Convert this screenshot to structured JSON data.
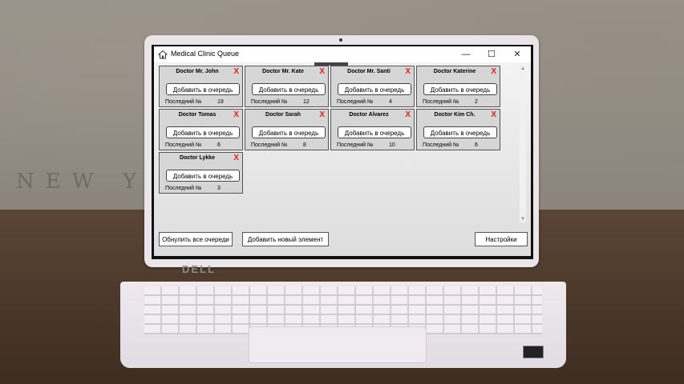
{
  "window": {
    "title": "Medical Clinic Queue",
    "minimize_glyph": "—",
    "maximize_glyph": "☐",
    "close_glyph": "✕"
  },
  "add_label": "Добавить в очередь",
  "last_label": "Последний №",
  "remove_glyph": "X",
  "doctors": [
    {
      "name": "Doctor Mr. John",
      "last": "19"
    },
    {
      "name": "Doctor Mr. Kate",
      "last": "12"
    },
    {
      "name": "Doctor Mr. Santi",
      "last": "4"
    },
    {
      "name": "Doctor Katerine",
      "last": "2"
    },
    {
      "name": "Doctor Tomas",
      "last": "6"
    },
    {
      "name": "Doctor Sarah",
      "last": "8"
    },
    {
      "name": "Doctor Alvarez",
      "last": "10"
    },
    {
      "name": "Doctor Kim Ch.",
      "last": "6"
    },
    {
      "name": "Doctor Lykke",
      "last": "3"
    }
  ],
  "footer": {
    "reset_label": "Обнулить все очереди",
    "add_new_label": "Добавить новый элемент",
    "settings_label": "Настройки"
  },
  "laptop_brand": "DELL",
  "wall_text": "NEW YO",
  "colors": {
    "remove": "#e02020",
    "card_bg": "#d6d6d6"
  },
  "icons": {
    "app": "house-icon",
    "scroll_up": "arrow-up-icon",
    "scroll_down": "arrow-down-icon"
  }
}
